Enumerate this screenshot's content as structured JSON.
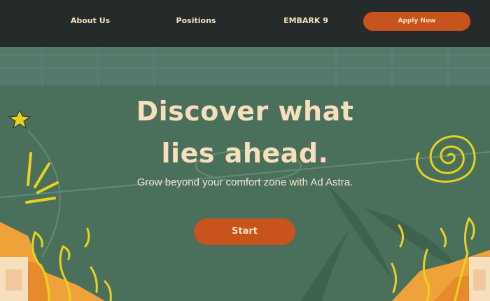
{
  "nav": {
    "links": [
      "About Us",
      "Positions",
      "EMBARK 9"
    ],
    "apply_label": "Apply Now"
  },
  "hero": {
    "headline_line1": "Discover what",
    "headline_line2": "lies ahead.",
    "subheadline": "Grow beyond your comfort zone with Ad Astra.",
    "start_label": "Start"
  },
  "colors": {
    "navbar": "#252b2b",
    "hero": "#4b725c",
    "accent": "#c8531c",
    "cream": "#f6dfbd",
    "yellow": "#e8d21f",
    "orange": "#f0a23a"
  }
}
